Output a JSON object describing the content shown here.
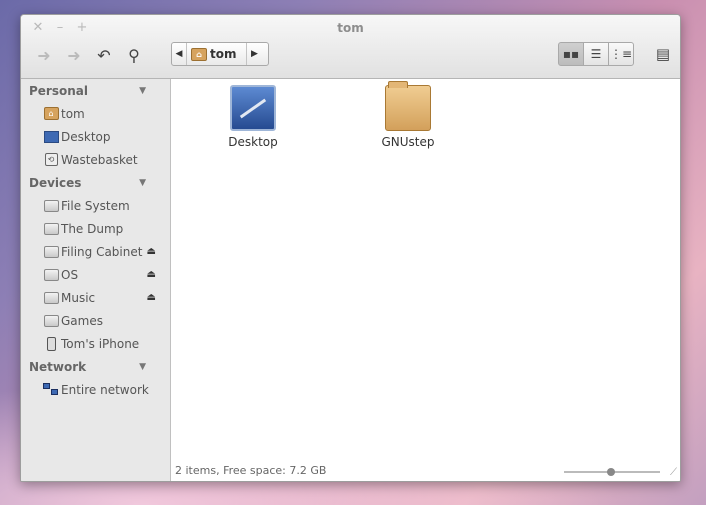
{
  "window": {
    "title": "tom"
  },
  "toolbar": {
    "path": [
      "tom"
    ],
    "view_modes": [
      "icon-view",
      "list-view",
      "column-view"
    ],
    "active_view": "icon-view"
  },
  "sidebar": {
    "sections": [
      {
        "title": "Personal",
        "items": [
          {
            "label": "tom",
            "icon": "home-folder-icon"
          },
          {
            "label": "Desktop",
            "icon": "desktop-icon"
          },
          {
            "label": "Wastebasket",
            "icon": "trash-icon"
          }
        ]
      },
      {
        "title": "Devices",
        "items": [
          {
            "label": "File System",
            "icon": "drive-icon"
          },
          {
            "label": "The Dump",
            "icon": "drive-icon"
          },
          {
            "label": "Filing Cabinet",
            "icon": "drive-icon",
            "eject": true
          },
          {
            "label": "OS",
            "icon": "drive-icon",
            "eject": true
          },
          {
            "label": "Music",
            "icon": "drive-icon",
            "eject": true
          },
          {
            "label": "Games",
            "icon": "drive-icon"
          },
          {
            "label": "Tom's iPhone",
            "icon": "phone-icon"
          }
        ]
      },
      {
        "title": "Network",
        "items": [
          {
            "label": "Entire network",
            "icon": "network-icon"
          }
        ]
      }
    ]
  },
  "files": [
    {
      "name": "Desktop",
      "icon": "desktop-folder-icon"
    },
    {
      "name": "GNUstep",
      "icon": "folder-icon"
    }
  ],
  "status": {
    "text": "2 items, Free space: 7.2 GB",
    "zoom": 0.5
  }
}
